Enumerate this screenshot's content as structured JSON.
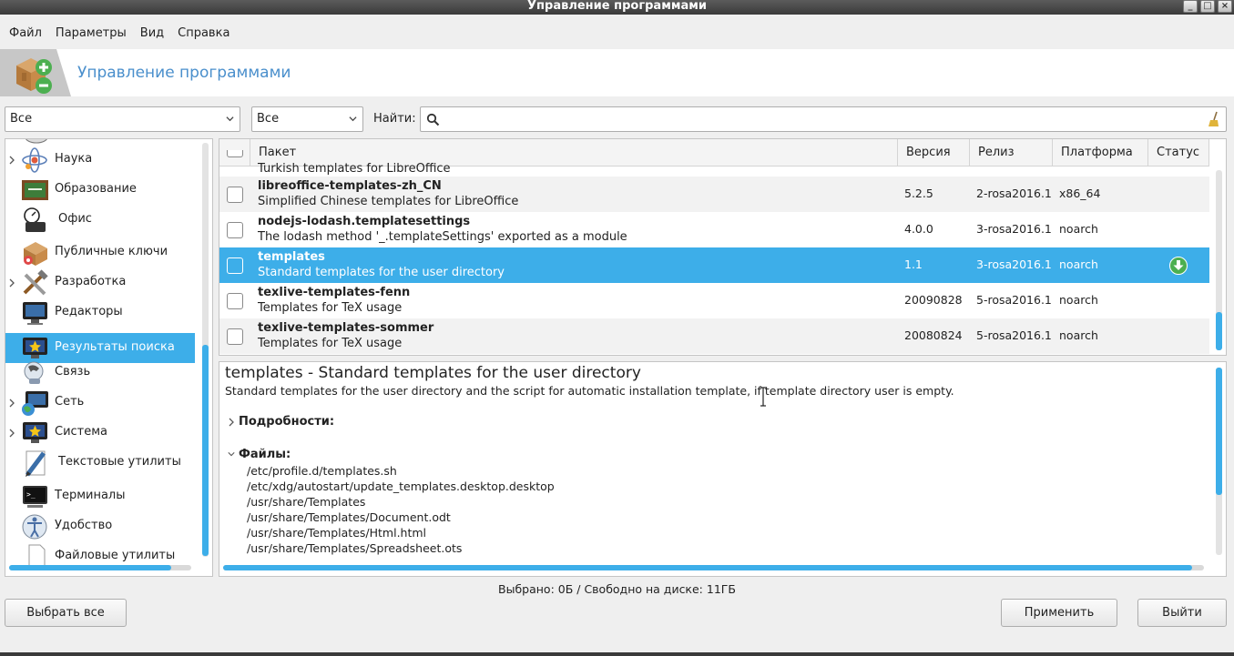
{
  "window": {
    "title": "Управление программами"
  },
  "menu": [
    "Файл",
    "Параметры",
    "Вид",
    "Справка"
  ],
  "banner": {
    "title": "Управление программами"
  },
  "filters": {
    "group": "Все",
    "state": "Все",
    "find_label": "Найти:",
    "search_value": ""
  },
  "categories": [
    {
      "label": "Наука",
      "expandable": true,
      "icon": "science-icon"
    },
    {
      "label": "Образование",
      "expandable": false,
      "icon": "education-icon"
    },
    {
      "label": "Офис",
      "expandable": false,
      "icon": "office-icon"
    },
    {
      "label": "Публичные ключи",
      "expandable": false,
      "icon": "keys-icon"
    },
    {
      "label": "Разработка",
      "expandable": true,
      "icon": "development-icon"
    },
    {
      "label": "Редакторы",
      "expandable": false,
      "icon": "editors-icon"
    },
    {
      "label": "Результаты поиска",
      "expandable": false,
      "selected": true,
      "icon": "search-results-icon"
    },
    {
      "label": "Связь",
      "expandable": false,
      "icon": "communication-icon"
    },
    {
      "label": "Сеть",
      "expandable": true,
      "icon": "network-icon"
    },
    {
      "label": "Система",
      "expandable": true,
      "icon": "system-icon"
    },
    {
      "label": "Текстовые утилиты",
      "expandable": false,
      "icon": "text-tools-icon"
    },
    {
      "label": "Терминалы",
      "expandable": false,
      "icon": "terminal-icon"
    },
    {
      "label": "Удобство",
      "expandable": false,
      "icon": "accessibility-icon"
    },
    {
      "label": "Файловые утилиты",
      "expandable": false,
      "icon": "file-tools-icon"
    }
  ],
  "package_table": {
    "columns": [
      "Пакет",
      "Версия",
      "Релиз",
      "Платформа",
      "Статус"
    ],
    "partial_row_desc": "Turkish templates for LibreOffice",
    "rows": [
      {
        "name": "libreoffice-templates-zh_CN",
        "description": "Simplified Chinese templates for LibreOffice",
        "version": "5.2.5",
        "release": "2-rosa2016.1",
        "platform": "x86_64",
        "status": ""
      },
      {
        "name": "nodejs-lodash.templatesettings",
        "description": "The lodash method '_.templateSettings' exported as a module",
        "version": "4.0.0",
        "release": "3-rosa2016.1",
        "platform": "noarch",
        "status": ""
      },
      {
        "name": "templates",
        "description": "Standard templates for the user directory",
        "version": "1.1",
        "release": "3-rosa2016.1",
        "platform": "noarch",
        "status": "install-icon",
        "selected": true
      },
      {
        "name": "texlive-templates-fenn",
        "description": "Templates for TeX usage",
        "version": "20090828",
        "release": "5-rosa2016.1",
        "platform": "noarch",
        "status": ""
      },
      {
        "name": "texlive-templates-sommer",
        "description": "Templates for TeX usage",
        "version": "20080824",
        "release": "5-rosa2016.1",
        "platform": "noarch",
        "status": ""
      }
    ]
  },
  "details": {
    "title": "templates - Standard templates for the user directory",
    "description": "Standard templates for the user directory and the script for automatic installation template, if template directory user is empty.",
    "details_label": "Подробности:",
    "files_label": "Файлы:",
    "files": [
      "/etc/profile.d/templates.sh",
      "/etc/xdg/autostart/update_templates.desktop.desktop",
      "/usr/share/Templates",
      "/usr/share/Templates/Document.odt",
      "/usr/share/Templates/Html.html",
      "/usr/share/Templates/Spreadsheet.ots"
    ]
  },
  "status_line": "Выбрано: 0Б / Свободно на диске: 11ГБ",
  "buttons": {
    "select_all": "Выбрать все",
    "apply": "Применить",
    "quit": "Выйти"
  },
  "colors": {
    "accent": "#3daee9",
    "banner_title": "#4a8fcc",
    "install_icon": "#4caf50"
  }
}
